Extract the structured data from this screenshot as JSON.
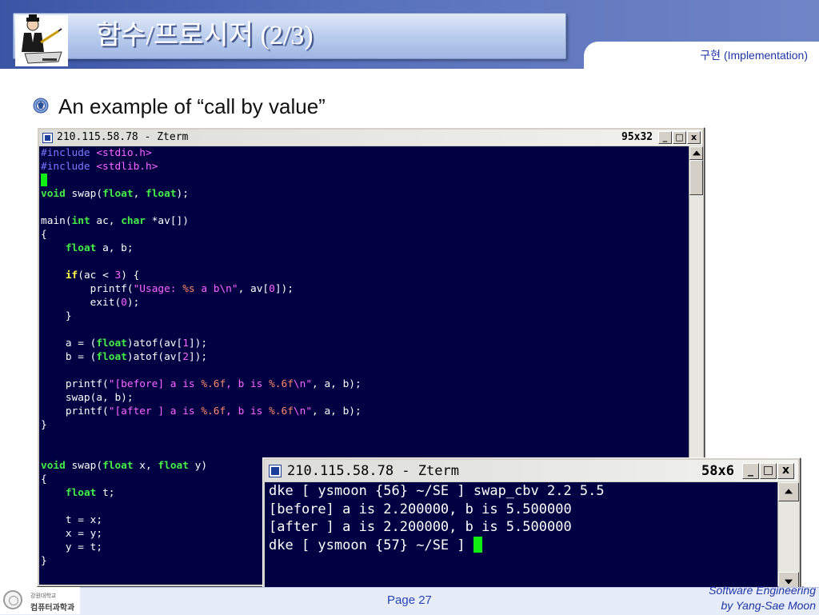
{
  "slide": {
    "title": "함수/프로시저 (2/3)",
    "section_tab": "구현 (Implementation)",
    "bullet": "An example of “call by value”"
  },
  "editor_window": {
    "title": "210.115.58.78 - Zterm",
    "size": "95x32",
    "buttons": {
      "minimize": "_",
      "maximize": "□",
      "close": "x"
    }
  },
  "code": {
    "l1_a": "#include ",
    "l1_b": "<stdio.h>",
    "l2_a": "#include ",
    "l2_b": "<stdlib.h>",
    "l4_a": "void",
    "l4_b": " swap(",
    "l4_c": "float",
    "l4_d": ", ",
    "l4_e": "float",
    "l4_f": ");",
    "l6_a": "main(",
    "l6_b": "int",
    "l6_c": " ac, ",
    "l6_d": "char",
    "l6_e": " *av[])",
    "l7": "{",
    "l8_a": "    ",
    "l8_b": "float",
    "l8_c": " a, b;",
    "l10_a": "    ",
    "l10_b": "if",
    "l10_c": "(ac < ",
    "l10_d": "3",
    "l10_e": ") {",
    "l11_a": "        printf(",
    "l11_b": "\"Usage: ",
    "l11_c": "%s",
    "l11_d": " a b\\n\"",
    "l11_e": ", av[",
    "l11_f": "0",
    "l11_g": "]);",
    "l12_a": "        exit(",
    "l12_b": "0",
    "l12_c": ");",
    "l13": "    }",
    "l15_a": "    a = (",
    "l15_b": "float",
    "l15_c": ")atof(av[",
    "l15_d": "1",
    "l15_e": "]);",
    "l16_a": "    b = (",
    "l16_b": "float",
    "l16_c": ")atof(av[",
    "l16_d": "2",
    "l16_e": "]);",
    "l18_a": "    printf(",
    "l18_b": "\"[before] a is ",
    "l18_c": "%.6f",
    "l18_d": ", b is ",
    "l18_e": "%.6f",
    "l18_f": "\\n\"",
    "l18_g": ", a, b);",
    "l19": "    swap(a, b);",
    "l20_a": "    printf(",
    "l20_b": "\"[after ] a is ",
    "l20_c": "%.6f",
    "l20_d": ", b is ",
    "l20_e": "%.6f",
    "l20_f": "\\n\"",
    "l20_g": ", a, b);",
    "l21": "}",
    "l24_a": "void",
    "l24_b": " swap(",
    "l24_c": "float",
    "l24_d": " x, ",
    "l24_e": "float",
    "l24_f": " y)",
    "l25": "{",
    "l26_a": "    ",
    "l26_b": "float",
    "l26_c": " t;",
    "l28": "    t = x;",
    "l29": "    x = y;",
    "l30": "    y = t;",
    "l31": "}"
  },
  "output_window": {
    "title": "210.115.58.78 - Zterm",
    "size": "58x6",
    "buttons": {
      "minimize": "_",
      "maximize": "□",
      "close": "x"
    },
    "lines": [
      "dke [ ysmoon {56} ~/SE ] swap_cbv 2.2 5.5",
      "[before] a is 2.200000, b is 5.500000",
      "[after ] a is 2.200000, b is 5.500000",
      "dke [ ysmoon {57} ~/SE ] "
    ]
  },
  "footer": {
    "university": "강원대학교",
    "department": "컴퓨터과학과",
    "page": "Page 27",
    "course": "Software Engineering",
    "author": "by Yang-Sae Moon"
  },
  "colors": {
    "header_blue": "#3b55a6",
    "terminal_bg": "#000042",
    "cursor_green": "#11ee11",
    "accent_text": "#1f35a8"
  }
}
